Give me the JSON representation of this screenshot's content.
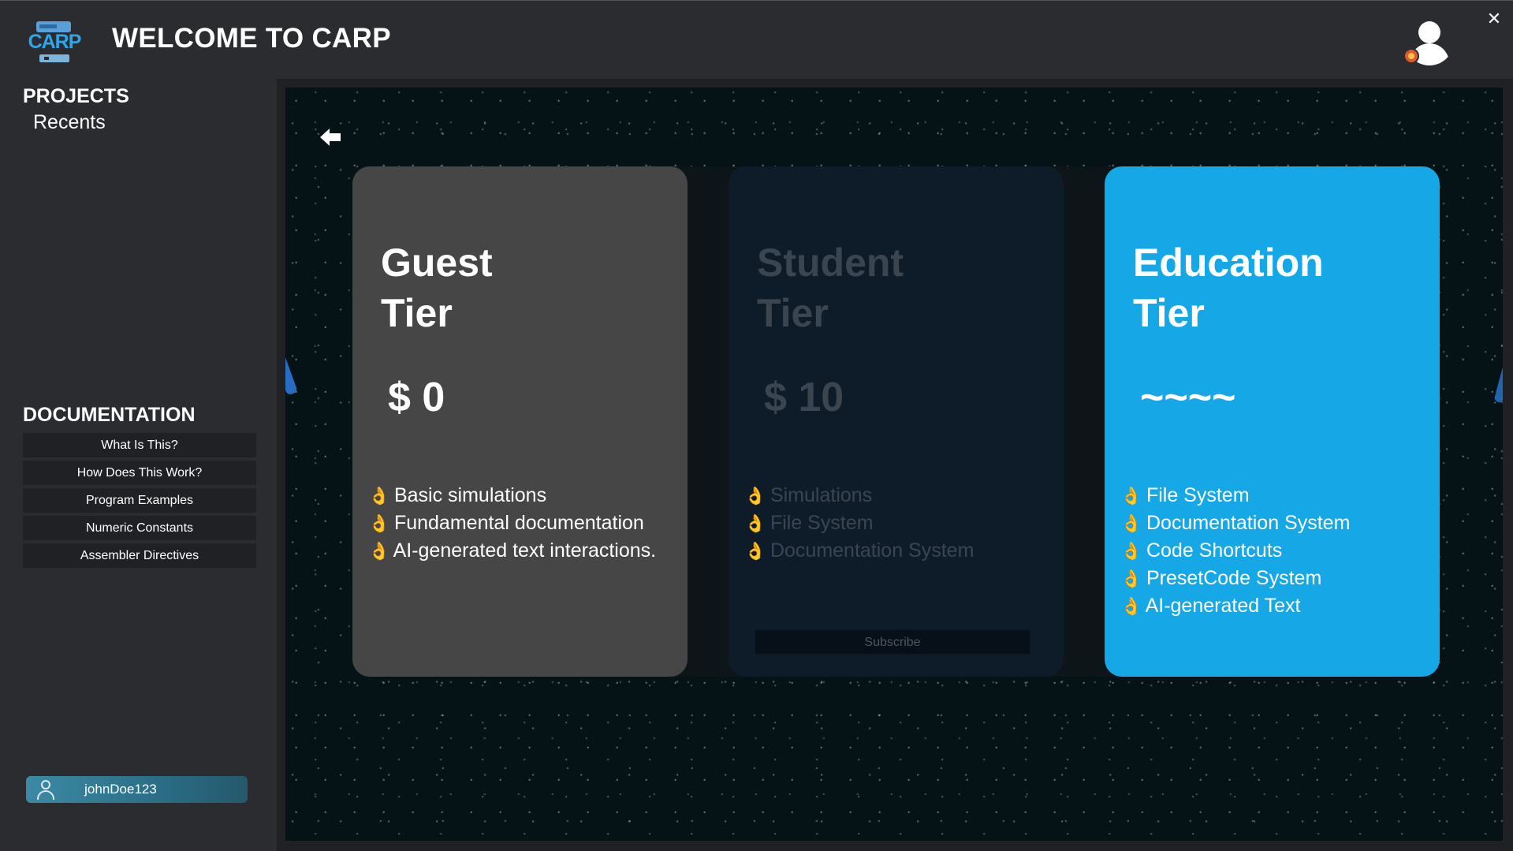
{
  "header": {
    "logo_text": "CARP",
    "title": "WELCOME TO CARP",
    "close_glyph": "✕"
  },
  "sidebar": {
    "projects_title": "PROJECTS",
    "recents_label": "Recents",
    "documentation_title": "DOCUMENTATION",
    "doc_items": [
      {
        "label": "What Is This?"
      },
      {
        "label": "How Does This Work?"
      },
      {
        "label": "Program Examples"
      },
      {
        "label": "Numeric Constants"
      },
      {
        "label": "Assembler Directives"
      }
    ],
    "user": {
      "username": "johnDoe123"
    }
  },
  "tiers": [
    {
      "name": "Guest\nTier",
      "price": "$ 0",
      "features": [
        "Basic simulations",
        "Fundamental documentation",
        "AI-generated text interactions."
      ]
    },
    {
      "name": "Student\nTier",
      "price": "$ 10",
      "features": [
        "Simulations",
        "File System",
        "Documentation System"
      ],
      "button_label": "Subscribe"
    },
    {
      "name": "Education\nTier",
      "price": "~~~~",
      "features": [
        "File System",
        "Documentation System",
        "Code Shortcuts",
        "PresetCode System",
        "AI-generated Text"
      ]
    }
  ],
  "bullet_glyph": "👌",
  "colors": {
    "guest_card": "#464646",
    "student_card": "#0e1c2a",
    "education_card": "#16a8e6",
    "background": "#2b2c30"
  }
}
